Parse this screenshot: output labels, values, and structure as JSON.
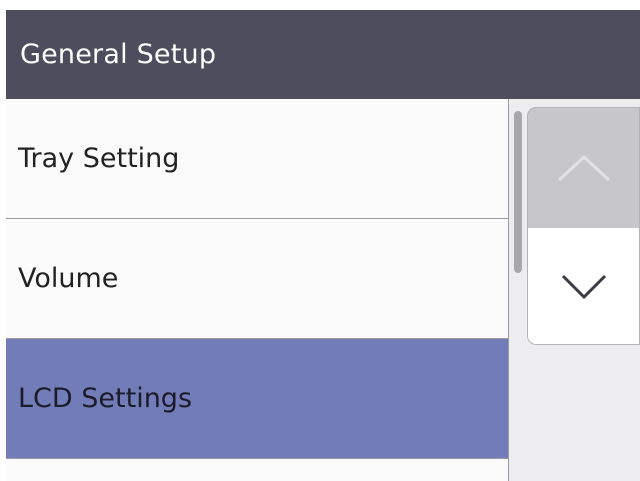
{
  "header": {
    "title": "General Setup"
  },
  "menu": {
    "items": [
      {
        "label": "Tray Setting",
        "selected": false
      },
      {
        "label": "Volume",
        "selected": false
      },
      {
        "label": "LCD Settings",
        "selected": true
      }
    ]
  },
  "scroll": {
    "up_icon": "chevron-up-icon",
    "down_icon": "chevron-down-icon",
    "up_enabled": false,
    "down_enabled": true
  },
  "colors": {
    "title_bar": "#4e4d5d",
    "selected_row": "#727cb8",
    "disabled_button": "#c7c7c9"
  }
}
